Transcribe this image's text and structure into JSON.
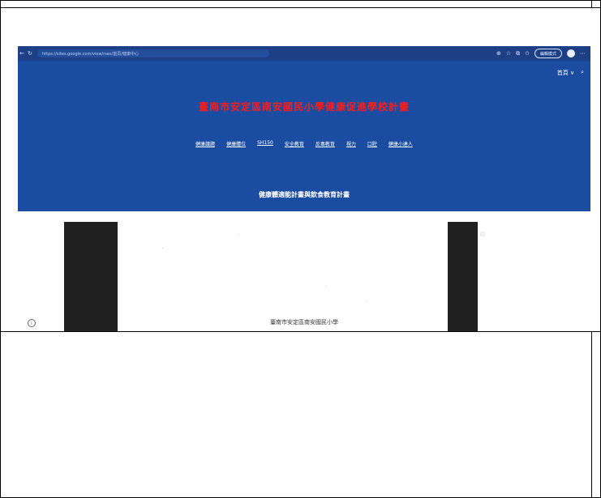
{
  "browser": {
    "url": "https://sites.google.com/view/rses/首頁/健康中心",
    "profile_pill": "編輯模式"
  },
  "site": {
    "menu_home": "首頁 ∨",
    "title": "臺南市安定區南安國民小學健康促進學校計畫",
    "nav": [
      "健康議題",
      "健康體位",
      "SH150",
      "安全教育",
      "反毒教育",
      "視力",
      "口腔",
      "健康小達人"
    ],
    "subtitle": "健康體適能計畫與飲食教育計畫"
  },
  "document": {
    "school_line": "臺南市安定區南安國民小學"
  },
  "icons": {
    "back": "back-arrow-icon",
    "reload": "reload-icon",
    "search": "search-icon",
    "open_new": "open-in-new-icon",
    "info": "info-icon"
  },
  "colors": {
    "hero": "#1a4da1",
    "title": "#ff1a1a",
    "addrbar": "#1d3f86"
  }
}
